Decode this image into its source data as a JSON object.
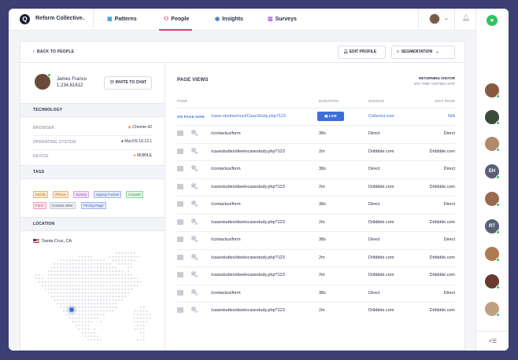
{
  "app": {
    "brand": "Reform Collective",
    "nav": [
      {
        "label": "Patterns",
        "icon": "grid-icon"
      },
      {
        "label": "People",
        "icon": "people-icon"
      },
      {
        "label": "Insights",
        "icon": "insights-icon"
      },
      {
        "label": "Surveys",
        "icon": "surveys-icon"
      }
    ],
    "active_nav": "People",
    "colors": {
      "accent": "#e53a6a",
      "link": "#3b6fd8",
      "online": "#2ec45f",
      "frame_bg": "#3b3f73"
    }
  },
  "header": {
    "back_label": "BACK TO PEOPLE",
    "edit_label": "EDIT PROFILE",
    "segmentation_label": "SEGMENTATION"
  },
  "profile": {
    "name": "James Franco",
    "phone": "1.234.61612",
    "invite_label": "INVITE TO CHAT"
  },
  "technology": {
    "title": "TECHNOLOGY",
    "rows": [
      {
        "key": "BROWSER",
        "value": "Chrome 62"
      },
      {
        "key": "OPERATING SYSTEM",
        "value": "MacOS 10.13.1"
      },
      {
        "key": "DEVICE",
        "value": "MOBILE"
      }
    ]
  },
  "tags": {
    "title": "TAGS",
    "items": [
      {
        "label": "Mobile",
        "bg": "#fde9d2",
        "border": "#f5b16a",
        "color": "#c0701f"
      },
      {
        "label": "iPhone",
        "bg": "#fde9d2",
        "border": "#f5b16a",
        "color": "#c0701f"
      },
      {
        "label": "Survey",
        "bg": "#f2e3fb",
        "border": "#d5a5f0",
        "color": "#8c3fbf"
      },
      {
        "label": "Signup Funnel",
        "bg": "#e3ebfd",
        "border": "#9db6f2",
        "color": "#3b5fc0"
      },
      {
        "label": "Convert",
        "bg": "#e3f6e6",
        "border": "#8ed59c",
        "color": "#2e8a45"
      },
      {
        "label": "Form",
        "bg": "#fde3ea",
        "border": "#f2a0b6",
        "color": "#c03c65"
      },
      {
        "label": "Contact Here",
        "bg": "#eceef3",
        "border": "#c7cbd6",
        "color": "#4b5065"
      },
      {
        "label": "Pricing Page",
        "bg": "#e3ebfd",
        "border": "#9db6f2",
        "color": "#3b5fc0"
      }
    ]
  },
  "location": {
    "title": "LOCATION",
    "place": "Santa Cruz, CA"
  },
  "page_views": {
    "title": "PAGE VIEWS",
    "returning_label": "RETURNING VISITOR",
    "visit_note": "6TH TIME VISITING SITE",
    "columns": [
      "PAGE",
      "DURATION",
      "SOURCE",
      "EXIT PAGE"
    ],
    "now": {
      "label": "ON PAGE NOW",
      "page": "/case-studies/nuvi/CaseStudy.php?123",
      "live_label": "LIVE",
      "source": "Collectui.com",
      "exit": "N/A"
    },
    "rows": [
      {
        "page": "/contactus/form",
        "duration": "38s",
        "source": "Direct",
        "exit": "Direct"
      },
      {
        "page": "/casestudies/dwelocasestudy.php?123",
        "duration": "2m",
        "source": "Dribbble.com",
        "exit": "Dribbble.com"
      },
      {
        "page": "/contactus/form",
        "duration": "38s",
        "source": "Direct",
        "exit": "Direct"
      },
      {
        "page": "/casestudies/dwelocasestudy.php?123",
        "duration": "2m",
        "source": "Dribbble.com",
        "exit": "Dribbble.com"
      },
      {
        "page": "/contactus/form",
        "duration": "38s",
        "source": "Direct",
        "exit": "Direct"
      },
      {
        "page": "/casestudies/dwelocasestudy.php?123",
        "duration": "2m",
        "source": "Dribbble.com",
        "exit": "Dribbble.com"
      },
      {
        "page": "/contactus/form",
        "duration": "38s",
        "source": "Direct",
        "exit": "Direct"
      },
      {
        "page": "/casestudies/dwelocasestudy.php?123",
        "duration": "2m",
        "source": "Dribbble.com",
        "exit": "Dribbble.com"
      },
      {
        "page": "/casestudies/dwelocasestudy.php?123",
        "duration": "2m",
        "source": "Dribbble.com",
        "exit": "Dribbble.com"
      },
      {
        "page": "/contactus/form",
        "duration": "38s",
        "source": "Direct",
        "exit": "Direct"
      },
      {
        "page": "/casestudies/dwelocasestudy.php?123",
        "duration": "2m",
        "source": "Dribbble.com",
        "exit": "Dribbble.com"
      }
    ]
  },
  "rail": {
    "avatars": [
      {
        "initials": "",
        "color": "#8a5a40"
      },
      {
        "initials": "",
        "color": "#3d4a3a"
      },
      {
        "initials": "",
        "color": "#b08a6a"
      },
      {
        "initials": "EH",
        "color": "#5a6075"
      },
      {
        "initials": "",
        "color": "#9a6a50"
      },
      {
        "initials": "RT",
        "color": "#5a6075"
      },
      {
        "initials": "",
        "color": "#b07a50"
      },
      {
        "initials": "",
        "color": "#6a3a30"
      },
      {
        "initials": "",
        "color": "#c0a080"
      }
    ],
    "collapse_label": "<☰"
  }
}
